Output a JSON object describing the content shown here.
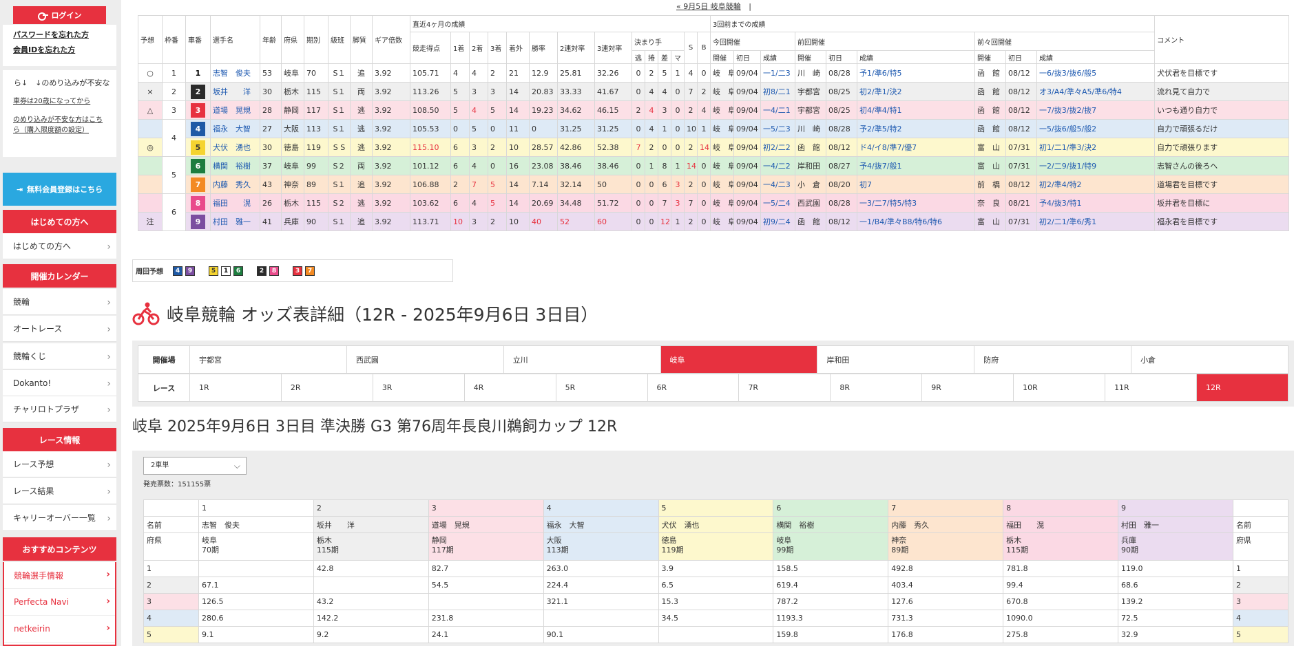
{
  "sidebar": {
    "login_label": "ログイン",
    "forgot_password": "パスワードを忘れた方",
    "forgot_member_id": "会員IDを忘れた方",
    "marquee_text": "ら↓　↓のめり込みが不安な",
    "age_notice": "車券は20歳になってから",
    "addiction_notice": "のめり込みが不安な方はこちら（購入限度額の設定）",
    "register_label": "無料会員登録はこちら",
    "first_head": "はじめての方へ",
    "first_item": "はじめての方へ",
    "calendar_head": "開催カレンダー",
    "calendar_items": [
      "競輪",
      "オートレース",
      "競輪くじ",
      "Dokanto!",
      "チャリロトプラザ"
    ],
    "race_info_head": "レース情報",
    "race_info_items": [
      "レース予想",
      "レース結果",
      "キャリーオーバー一覧"
    ],
    "recommend_head": "おすすめコンテンツ",
    "recommend_items": [
      "競輪選手情報",
      "Perfecta Navi",
      "netkeirin"
    ]
  },
  "topnav": {
    "prev_link": "« 9月5日 岐阜競輪",
    "sep": "|"
  },
  "entry": {
    "headers": {
      "yoso": "予想",
      "waku": "枠番",
      "sha": "車番",
      "name": "選手名",
      "age": "年齢",
      "pref": "府県",
      "term": "期別",
      "class": "級班",
      "leg": "脚質",
      "gear": "ギア倍数",
      "recent4": "直近4ヶ月の成績",
      "score": "競走得点",
      "w1": "1着",
      "w2": "2着",
      "w3": "3着",
      "out": "着外",
      "rate1": "勝率",
      "rate2": "2連対率",
      "rate3": "3連対率",
      "kimarite": "決まり手",
      "nige": "逃",
      "makuri": "捲",
      "sashi": "差",
      "mark": "マ",
      "s": "S",
      "b": "B",
      "past3": "3回前までの成績",
      "cur": "今回開催",
      "prev": "前回開催",
      "prev2": "前々回開催",
      "kaisai": "開催",
      "first_day": "初日",
      "result": "成績",
      "comment": "コメント"
    },
    "rows": [
      {
        "yoso": "○",
        "waku": "1",
        "sha": "1",
        "name": "志智　俊夫",
        "age": "53",
        "pref": "岐阜",
        "term": "70",
        "class": "S１",
        "leg": "追",
        "gear": "3.92",
        "score": "105.71",
        "w1": "4",
        "w2": "4",
        "w3": "2",
        "out": "21",
        "r1": "12.9",
        "r2": "25.81",
        "r3": "32.26",
        "nige": "0",
        "makuri": "2",
        "sashi": "5",
        "mark": "1",
        "s": "4",
        "b": "0",
        "cv": "岐　阜",
        "cd": "09/04",
        "cr": "一1/二3",
        "pv": "川　崎",
        "pd": "08/28",
        "pr": "予1/準6/特5",
        "qv": "函　館",
        "qd": "08/12",
        "qr": "一6/抜3/抜6/般5",
        "comment": "犬伏君を目標です"
      },
      {
        "yoso": "×",
        "waku": "2",
        "sha": "2",
        "name": "坂井　　洋",
        "age": "30",
        "pref": "栃木",
        "term": "115",
        "class": "S１",
        "leg": "両",
        "gear": "3.92",
        "score": "113.26",
        "w1": "5",
        "w2": "3",
        "w3": "3",
        "out": "14",
        "r1": "20.83",
        "r2": "33.33",
        "r3": "41.67",
        "nige": "0",
        "makuri": "4",
        "sashi": "4",
        "mark": "0",
        "s": "7",
        "b": "2",
        "cv": "岐　阜",
        "cd": "09/04",
        "cr": "初8/二1",
        "pv": "宇都宮",
        "pd": "08/25",
        "pr": "初2/準1/決2",
        "qv": "函　館",
        "qd": "08/12",
        "qr": "オ3/A4/準々A5/準6/特4",
        "comment": "流れ見て自力で"
      },
      {
        "yoso": "△",
        "waku": "3",
        "sha": "3",
        "name": "道場　晃規",
        "age": "28",
        "pref": "静岡",
        "term": "117",
        "class": "S１",
        "leg": "逃",
        "gear": "3.92",
        "score": "108.50",
        "w1": "5",
        "w2": "4",
        "w3": "5",
        "out": "14",
        "r1": "19.23",
        "r2": "34.62",
        "r3": "46.15",
        "nige": "2",
        "makuri": "4",
        "sashi": "3",
        "mark": "0",
        "s": "2",
        "b": "4",
        "cv": "岐　阜",
        "cd": "09/04",
        "cr": "一4/二1",
        "pv": "宇都宮",
        "pd": "08/25",
        "pr": "初4/準4/特1",
        "qv": "函　館",
        "qd": "08/12",
        "qr": "一7/抜3/抜2/抜7",
        "comment": "いつも通り自力で"
      },
      {
        "yoso": "",
        "waku": "4",
        "sha": "4",
        "name": "福永　大智",
        "age": "27",
        "pref": "大阪",
        "term": "113",
        "class": "S１",
        "leg": "逃",
        "gear": "3.92",
        "score": "105.53",
        "w1": "0",
        "w2": "5",
        "w3": "0",
        "out": "11",
        "r1": "0",
        "r2": "31.25",
        "r3": "31.25",
        "nige": "0",
        "makuri": "4",
        "sashi": "1",
        "mark": "0",
        "s": "10",
        "b": "1",
        "cv": "岐　阜",
        "cd": "09/04",
        "cr": "一5/二3",
        "pv": "川　崎",
        "pd": "08/28",
        "pr": "予2/準5/特2",
        "qv": "函　館",
        "qd": "08/12",
        "qr": "一5/抜6/般5/般2",
        "comment": "自力で頑張るだけ"
      },
      {
        "yoso": "◎",
        "waku": "",
        "sha": "5",
        "name": "犬伏　湧也",
        "age": "30",
        "pref": "徳島",
        "term": "119",
        "class": "S S",
        "leg": "逃",
        "gear": "3.92",
        "score": "115.10",
        "w1": "6",
        "w2": "3",
        "w3": "2",
        "out": "10",
        "r1": "28.57",
        "r2": "42.86",
        "r3": "52.38",
        "nige": "7",
        "makuri": "2",
        "sashi": "0",
        "mark": "0",
        "s": "2",
        "b": "14",
        "cv": "岐　阜",
        "cd": "09/04",
        "cr": "初2/二2",
        "pv": "函　館",
        "pd": "08/12",
        "pr": "ド4/イ8/準7/優7",
        "qv": "富　山",
        "qd": "07/31",
        "qr": "初1/二1/準3/決2",
        "comment": "自力で頑張ります"
      },
      {
        "yoso": "",
        "waku": "5",
        "sha": "6",
        "name": "横関　裕樹",
        "age": "37",
        "pref": "岐阜",
        "term": "99",
        "class": "S２",
        "leg": "両",
        "gear": "3.92",
        "score": "101.12",
        "w1": "6",
        "w2": "4",
        "w3": "0",
        "out": "16",
        "r1": "23.08",
        "r2": "38.46",
        "r3": "38.46",
        "nige": "0",
        "makuri": "1",
        "sashi": "8",
        "mark": "1",
        "s": "14",
        "b": "0",
        "cv": "岐　阜",
        "cd": "09/04",
        "cr": "一4/二2",
        "pv": "岸和田",
        "pd": "08/27",
        "pr": "予4/抜7/般1",
        "qv": "富　山",
        "qd": "07/31",
        "qr": "一2/二9/抜1/特9",
        "comment": "志智さんの後ろへ"
      },
      {
        "yoso": "",
        "waku": "",
        "sha": "7",
        "name": "内藤　秀久",
        "age": "43",
        "pref": "神奈",
        "term": "89",
        "class": "S１",
        "leg": "追",
        "gear": "3.92",
        "score": "106.88",
        "w1": "2",
        "w2": "7",
        "w3": "5",
        "out": "14",
        "r1": "7.14",
        "r2": "32.14",
        "r3": "50",
        "nige": "0",
        "makuri": "0",
        "sashi": "6",
        "mark": "3",
        "s": "2",
        "b": "0",
        "cv": "岐　阜",
        "cd": "09/04",
        "cr": "一4/二3",
        "pv": "小　倉",
        "pd": "08/20",
        "pr": "初7",
        "qv": "前　橋",
        "qd": "08/12",
        "qr": "初2/準4/特2",
        "comment": "道場君を目標です"
      },
      {
        "yoso": "",
        "waku": "6",
        "sha": "8",
        "name": "福田　　滉",
        "age": "26",
        "pref": "栃木",
        "term": "115",
        "class": "S２",
        "leg": "逃",
        "gear": "3.92",
        "score": "103.62",
        "w1": "6",
        "w2": "4",
        "w3": "5",
        "out": "14",
        "r1": "20.69",
        "r2": "34.48",
        "r3": "51.72",
        "nige": "0",
        "makuri": "0",
        "sashi": "7",
        "mark": "3",
        "s": "7",
        "b": "0",
        "cv": "岐　阜",
        "cd": "09/04",
        "cr": "一5/二4",
        "pv": "西武園",
        "pd": "08/28",
        "pr": "一3/二7/特5/特3",
        "qv": "奈　良",
        "qd": "08/21",
        "qr": "予4/抜3/特1",
        "comment": "坂井君を目標に"
      },
      {
        "yoso": "注",
        "waku": "",
        "sha": "9",
        "name": "村田　雅一",
        "age": "41",
        "pref": "兵庫",
        "term": "90",
        "class": "S１",
        "leg": "追",
        "gear": "3.92",
        "score": "113.71",
        "w1": "10",
        "w2": "3",
        "w3": "2",
        "out": "10",
        "r1": "40",
        "r2": "52",
        "r3": "60",
        "nige": "0",
        "makuri": "0",
        "sashi": "12",
        "mark": "1",
        "s": "2",
        "b": "0",
        "cv": "岐　阜",
        "cd": "09/04",
        "cr": "初9/二4",
        "pv": "函　館",
        "pd": "08/12",
        "pr": "一1/B4/準々B8/特6/特6",
        "qv": "富　山",
        "qd": "07/31",
        "qr": "初2/二1/準6/秀1",
        "comment": "福永君を目標です"
      }
    ]
  },
  "lineup": {
    "label": "周回予想",
    "groups": [
      [
        "4",
        "9"
      ],
      [
        "5",
        "1",
        "6"
      ],
      [
        "2",
        "8"
      ],
      [
        "3",
        "7"
      ]
    ]
  },
  "title": "岐阜競輪 オッズ表詳細（12R - 2025年9月6日 3日目）",
  "venues": {
    "label": "開催場",
    "items": [
      "宇都宮",
      "西武園",
      "立川",
      "岐阜",
      "岸和田",
      "防府",
      "小倉"
    ],
    "active": 3
  },
  "races": {
    "label": "レース",
    "items": [
      "1R",
      "2R",
      "3R",
      "4R",
      "5R",
      "6R",
      "7R",
      "8R",
      "9R",
      "10R",
      "11R",
      "12R"
    ],
    "active": 11
  },
  "race_title": "岐阜 2025年9月6日 3日目 準決勝 G3 第76周年長良川鵜飼カップ 12R",
  "odds": {
    "bet_type": "2車単",
    "sold_label": "発売票数：151155票",
    "name_label": "名前",
    "pref_label": "府県",
    "riders": [
      {
        "no": "1",
        "name": "志智　俊夫",
        "pref": "岐阜",
        "term": "70期"
      },
      {
        "no": "2",
        "name": "坂井　　洋",
        "pref": "栃木",
        "term": "115期"
      },
      {
        "no": "3",
        "name": "道場　晃規",
        "pref": "静岡",
        "term": "117期"
      },
      {
        "no": "4",
        "name": "福永　大智",
        "pref": "大阪",
        "term": "113期"
      },
      {
        "no": "5",
        "name": "犬伏　湧也",
        "pref": "徳島",
        "term": "119期"
      },
      {
        "no": "6",
        "name": "横関　裕樹",
        "pref": "岐阜",
        "term": "99期"
      },
      {
        "no": "7",
        "name": "内藤　秀久",
        "pref": "神奈",
        "term": "89期"
      },
      {
        "no": "8",
        "name": "福田　　滉",
        "pref": "栃木",
        "term": "115期"
      },
      {
        "no": "9",
        "name": "村田　雅一",
        "pref": "兵庫",
        "term": "90期"
      }
    ],
    "rows": [
      {
        "no": "1",
        "vals": [
          "",
          "42.8",
          "82.7",
          "263.0",
          "3.9",
          "158.5",
          "492.8",
          "781.8",
          "119.0"
        ]
      },
      {
        "no": "2",
        "vals": [
          "67.1",
          "",
          "54.5",
          "224.4",
          "6.5",
          "619.4",
          "403.4",
          "99.4",
          "68.6"
        ]
      },
      {
        "no": "3",
        "vals": [
          "126.5",
          "43.2",
          "",
          "321.1",
          "15.3",
          "787.2",
          "127.6",
          "670.8",
          "139.2"
        ]
      },
      {
        "no": "4",
        "vals": [
          "280.6",
          "142.2",
          "231.8",
          "",
          "34.5",
          "1193.3",
          "731.3",
          "1090.0",
          "72.5"
        ]
      },
      {
        "no": "5",
        "vals": [
          "9.1",
          "9.2",
          "24.1",
          "90.1",
          "",
          "159.8",
          "176.8",
          "275.8",
          "32.9"
        ]
      }
    ]
  },
  "colors": {
    "accent": "#e7313f",
    "bike": [
      "#ffffff",
      "#2b2b2b",
      "#e7313f",
      "#1f5aa6",
      "#f5d430",
      "#1d7d3f",
      "#f38a23",
      "#e94b8b",
      "#7b4ea0"
    ],
    "bike_text": [
      "#000000",
      "#ffffff",
      "#ffffff",
      "#ffffff",
      "#333333",
      "#ffffff",
      "#ffffff",
      "#ffffff",
      "#ffffff"
    ],
    "row_bg": [
      "#ffffff",
      "#efefef",
      "#fce0e6",
      "#deeaf6",
      "#fdf8cd",
      "#d6f0d8",
      "#fde5cf",
      "#fbd9e4",
      "#ebdcf0"
    ]
  }
}
